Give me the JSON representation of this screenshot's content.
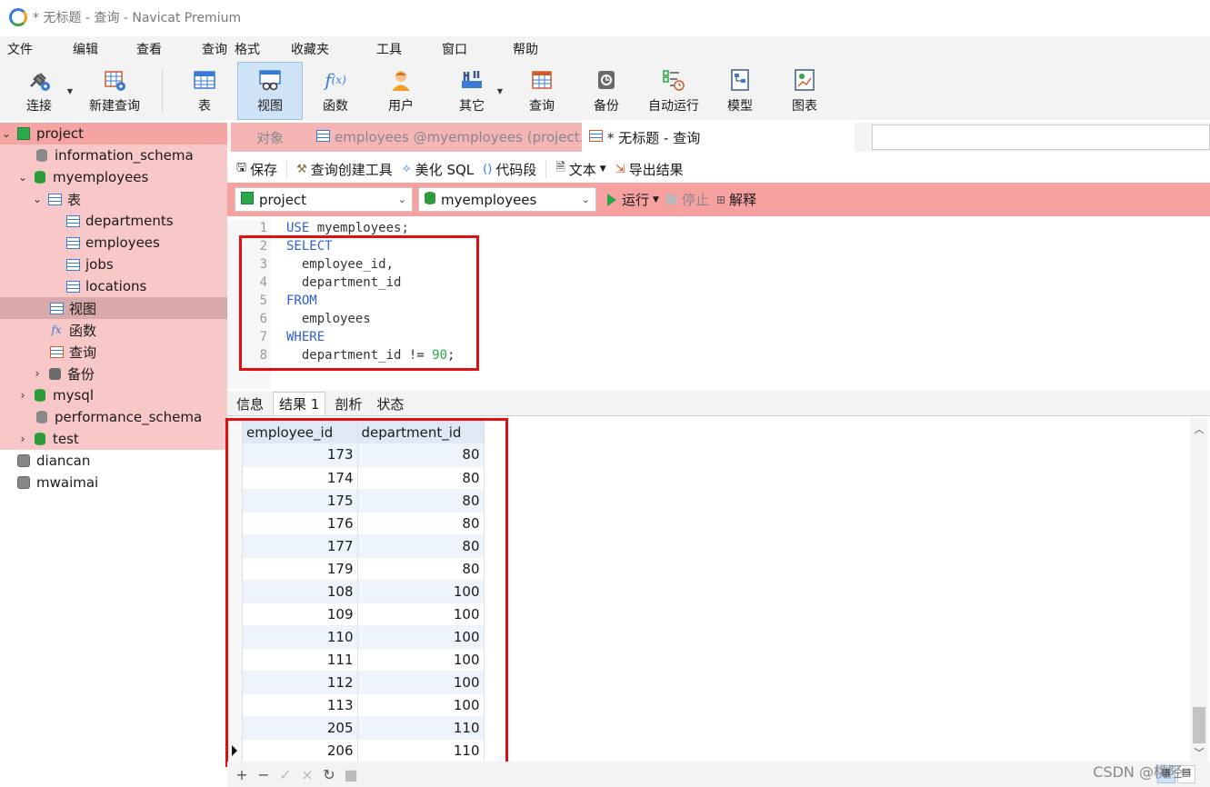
{
  "window": {
    "title": "* 无标题 - 查询 - Navicat Premium"
  },
  "menu": [
    "文件",
    "编辑",
    "查看",
    "查询",
    "格式",
    "收藏夹",
    "工具",
    "窗口",
    "帮助"
  ],
  "toolbar": {
    "connect": "连接",
    "new_query": "新建查询",
    "table": "表",
    "view": "视图",
    "function": "函数",
    "user": "用户",
    "other": "其它",
    "query": "查询",
    "backup": "备份",
    "autorun": "自动运行",
    "model": "模型",
    "chart": "图表"
  },
  "sidebar": {
    "project": "project",
    "information_schema": "information_schema",
    "myemployees": "myemployees",
    "tables_group": "表",
    "tables": [
      "departments",
      "employees",
      "jobs",
      "locations"
    ],
    "views_group": "视图",
    "functions_group": "函数",
    "queries_group": "查询",
    "backups_group": "备份",
    "mysql": "mysql",
    "performance_schema": "performance_schema",
    "test": "test",
    "diancan": "diancan",
    "mwaimai": "mwaimai"
  },
  "tabs": {
    "objects": "对象",
    "employees": "employees @myemployees (project...",
    "current": "* 无标题 - 查询"
  },
  "editor_toolbar": {
    "save": "保存",
    "builder": "查询创建工具",
    "beautify": "美化 SQL",
    "snippet": "代码段",
    "text": "文本",
    "export": "导出结果"
  },
  "connection": {
    "conn": "project",
    "db": "myemployees",
    "run": "运行",
    "stop": "停止",
    "explain": "解释"
  },
  "code_lines": [
    {
      "n": "1",
      "kw": "USE",
      "rest": " myemployees;"
    },
    {
      "n": "2",
      "kw": "SELECT",
      "rest": ""
    },
    {
      "n": "3",
      "kw": "",
      "rest": "  employee_id,"
    },
    {
      "n": "4",
      "kw": "",
      "rest": "  department_id"
    },
    {
      "n": "5",
      "kw": "FROM",
      "rest": ""
    },
    {
      "n": "6",
      "kw": "",
      "rest": "  employees"
    },
    {
      "n": "7",
      "kw": "WHERE",
      "rest": ""
    },
    {
      "n": "8",
      "kw": "",
      "rest": "  department_id != ",
      "num": "90",
      "tail": ";"
    }
  ],
  "result_tabs": [
    "信息",
    "结果 1",
    "剖析",
    "状态"
  ],
  "result": {
    "headers": [
      "employee_id",
      "department_id"
    ],
    "rows": [
      [
        "173",
        "80"
      ],
      [
        "174",
        "80"
      ],
      [
        "175",
        "80"
      ],
      [
        "176",
        "80"
      ],
      [
        "177",
        "80"
      ],
      [
        "179",
        "80"
      ],
      [
        "108",
        "100"
      ],
      [
        "109",
        "100"
      ],
      [
        "110",
        "100"
      ],
      [
        "111",
        "100"
      ],
      [
        "112",
        "100"
      ],
      [
        "113",
        "100"
      ],
      [
        "205",
        "110"
      ],
      [
        "206",
        "110"
      ]
    ]
  },
  "watermark": "CSDN @桃陉"
}
